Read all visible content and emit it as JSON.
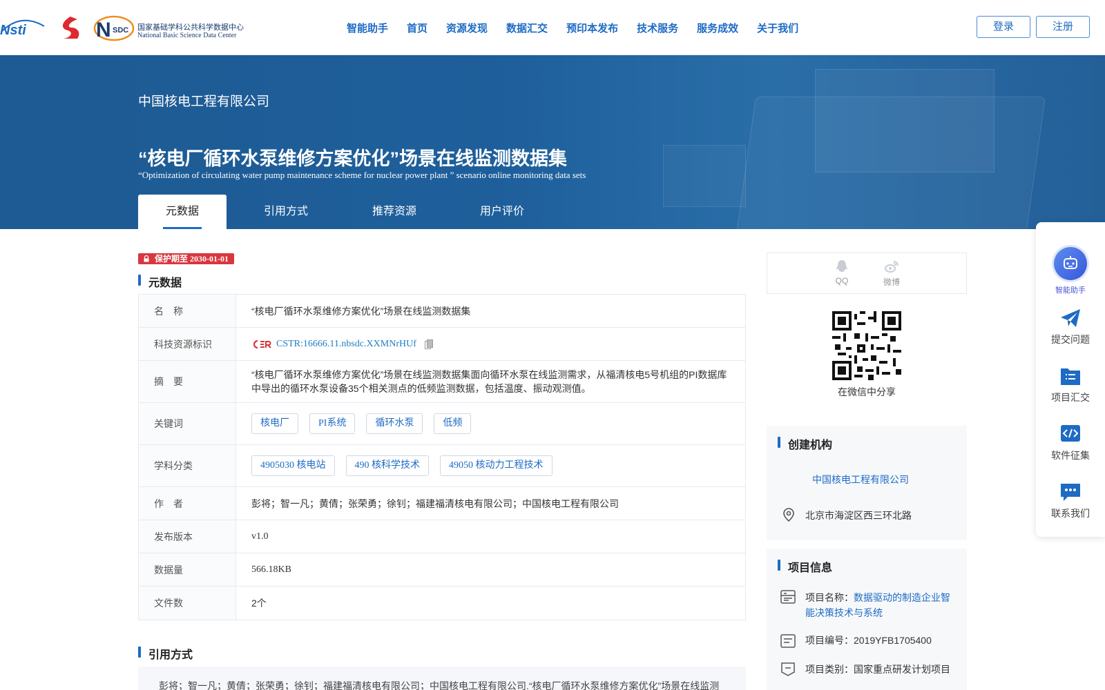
{
  "header": {
    "logo_text_cn": "国家基础学科公共科学数据中心",
    "logo_text_en": "National Basic Science Data Center",
    "nav": [
      "智能助手",
      "首页",
      "资源发现",
      "数据汇交",
      "预印本发布",
      "技术服务",
      "服务成效",
      "关于我们"
    ],
    "login": "登录",
    "register": "注册"
  },
  "banner": {
    "org": "中国核电工程有限公司",
    "title_cn": "“核电厂循环水泵维修方案优化”场景在线监测数据集",
    "title_en": "“Optimization of circulating water pump maintenance scheme for nuclear power plant ” scenario online monitoring data sets",
    "tabs": [
      "元数据",
      "引用方式",
      "推荐资源",
      "用户评价"
    ]
  },
  "main": {
    "protect": "保护期至 2030-01-01",
    "section_meta": "元数据",
    "section_cite": "引用方式",
    "rows": {
      "name_k": "名　称",
      "name_v": "“核电厂循环水泵维修方案优化”场景在线监测数据集",
      "cstr_k": "科技资源标识",
      "cstr_logo": "CSTR",
      "cstr_v": "CSTR:16666.11.nbsdc.XXMNrHUf",
      "abstract_k": "摘　要",
      "abstract_v": "“核电厂循环水泵维修方案优化”场景在线监测数据集面向循环水泵在线监测需求，从福清核电5号机组的PI数据库中导出的循环水泵设备35个相关测点的低频监测数据，包括温度、振动观测值。",
      "keywords_k": "关键词",
      "keywords": [
        "核电厂",
        "PI系统",
        "循环水泵",
        "低频"
      ],
      "subject_k": "学科分类",
      "subjects": [
        "4905030 核电站",
        "490 核科学技术",
        "49050 核动力工程技术"
      ],
      "author_k": "作　者",
      "author_v": "彭将；智一凡；黄倩；张荣勇；徐钊；福建福清核电有限公司；中国核电工程有限公司",
      "version_k": "发布版本",
      "version_v": "v1.0",
      "size_k": "数据量",
      "size_v": "566.18KB",
      "files_k": "文件数",
      "files_v": "2个"
    },
    "cite_text": "彭将；智一凡；黄倩；张荣勇；徐钊；福建福清核电有限公司；中国核电工程有限公司.“核电厂循环水泵维修方案优化”场景在线监测"
  },
  "right": {
    "share_qq": "QQ",
    "share_weibo": "微博",
    "qr_caption": "在微信中分享",
    "creator_title": "创建机构",
    "creator_org": "中国核电工程有限公司",
    "address": "北京市海淀区西三环北路",
    "project_title": "项目信息",
    "project_name_label": "项目名称：",
    "project_name": "数据驱动的制造企业智能决策技术与系统",
    "project_no": "项目编号：2019YFB1705400",
    "project_type": "项目类别：国家重点研发计划项目"
  },
  "float": {
    "ai": "智能助手",
    "submit_question": "提交问题",
    "project_submit": "项目汇交",
    "software": "软件征集",
    "contact": "联系我们"
  },
  "colors": {
    "brand_blue": "#1e6bc4",
    "banner_blue": "#1e5f9b",
    "protect_red": "#d9363e"
  }
}
